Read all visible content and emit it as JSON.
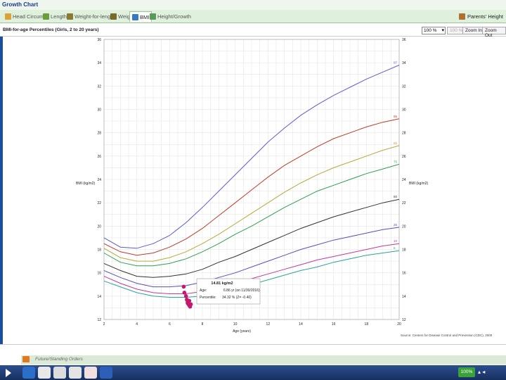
{
  "window": {
    "title": "Growth Chart"
  },
  "tabs": [
    {
      "label": "Head Circum",
      "icon": "head-icon",
      "active": false
    },
    {
      "label": "Length",
      "icon": "length-icon",
      "active": false
    },
    {
      "label": "Weight-for-length",
      "icon": "weight-for-length-icon",
      "active": false
    },
    {
      "label": "Weight",
      "icon": "weight-icon",
      "active": false
    },
    {
      "label": "BMI",
      "icon": "bmi-icon",
      "active": true
    },
    {
      "label": "Height/Growth",
      "icon": "height-icon",
      "active": false
    }
  ],
  "toolbar": {
    "parents_height": "Parents' Height"
  },
  "subbar": {
    "chart_title": "BMI-for-age Percentiles (Girls, 2 to 20 years)",
    "zoom_value": "100 %",
    "zoom_display": "100 %",
    "zoom_in": "Zoom In",
    "zoom_out": "Zoom Out"
  },
  "tooltip": {
    "value": "14.81 kg/m2",
    "age_label": "Age:",
    "age_value": "6.86 yr (on 11/30/2016)",
    "percentile_label": "Percentile:",
    "percentile_value": "34.32 % (Z= -0.40)"
  },
  "source": "Source: Centers for Disease Control and Prevention (CDC), 2000",
  "orders": {
    "label": "Future/Standing Orders"
  },
  "taskbar": {
    "tray_label": "100%"
  },
  "chart_data": {
    "type": "line",
    "xlabel": "Age (years)",
    "ylabel": "BMI (kg/m2)",
    "ylabel_right": "BMI (kg/m2)",
    "xlim": [
      2,
      20
    ],
    "ylim": [
      12,
      36
    ],
    "x_ticks": [
      2,
      4,
      6,
      8,
      10,
      12,
      14,
      16,
      18,
      20
    ],
    "y_ticks": [
      12,
      14,
      16,
      18,
      20,
      22,
      24,
      26,
      28,
      30,
      32,
      34,
      36
    ],
    "x": [
      2,
      3,
      4,
      5,
      6,
      7,
      8,
      9,
      10,
      11,
      12,
      13,
      14,
      15,
      16,
      17,
      18,
      19,
      20
    ],
    "series": [
      {
        "name": "97",
        "color": "#5b5bd6",
        "values": [
          19.0,
          18.2,
          18.1,
          18.5,
          19.2,
          20.3,
          21.6,
          23.0,
          24.4,
          25.8,
          27.2,
          28.4,
          29.5,
          30.4,
          31.2,
          31.9,
          32.6,
          33.2,
          33.8
        ]
      },
      {
        "name": "95",
        "color": "#c0392b",
        "values": [
          18.5,
          17.8,
          17.5,
          17.7,
          18.2,
          18.9,
          19.8,
          20.9,
          22.0,
          23.1,
          24.2,
          25.2,
          26.0,
          26.8,
          27.5,
          28.0,
          28.5,
          28.9,
          29.2
        ]
      },
      {
        "name": "85",
        "color": "#b8a838",
        "values": [
          18.1,
          17.3,
          17.0,
          17.0,
          17.3,
          17.8,
          18.5,
          19.3,
          20.2,
          21.1,
          22.0,
          22.9,
          23.7,
          24.4,
          25.0,
          25.5,
          26.0,
          26.5,
          26.9
        ]
      },
      {
        "name": "75",
        "color": "#2e9e52",
        "values": [
          17.7,
          16.9,
          16.6,
          16.6,
          16.8,
          17.2,
          17.8,
          18.5,
          19.3,
          20.0,
          20.8,
          21.6,
          22.3,
          23.0,
          23.5,
          24.0,
          24.5,
          24.9,
          25.3
        ]
      },
      {
        "name": "50",
        "color": "#333333",
        "values": [
          16.8,
          16.2,
          15.7,
          15.6,
          15.7,
          15.9,
          16.3,
          16.9,
          17.4,
          18.0,
          18.6,
          19.2,
          19.8,
          20.3,
          20.8,
          21.2,
          21.6,
          22.0,
          22.3
        ]
      },
      {
        "name": "25",
        "color": "#5a4fb8",
        "values": [
          16.2,
          15.6,
          15.1,
          14.8,
          14.8,
          14.9,
          15.2,
          15.6,
          16.0,
          16.5,
          17.0,
          17.5,
          18.0,
          18.4,
          18.8,
          19.1,
          19.4,
          19.7,
          19.9
        ]
      },
      {
        "name": "10",
        "color": "#c03a9b",
        "values": [
          15.7,
          15.1,
          14.6,
          14.3,
          14.2,
          14.2,
          14.4,
          14.7,
          15.1,
          15.5,
          15.9,
          16.3,
          16.7,
          17.1,
          17.4,
          17.7,
          18.0,
          18.3,
          18.5
        ]
      },
      {
        "name": "5",
        "color": "#2aa39a",
        "values": [
          15.3,
          14.8,
          14.3,
          14.0,
          13.9,
          13.9,
          14.0,
          14.3,
          14.6,
          15.0,
          15.4,
          15.8,
          16.2,
          16.5,
          16.9,
          17.2,
          17.5,
          17.7,
          17.9
        ]
      }
    ],
    "patient_points": {
      "color": "#c2186e",
      "x": [
        6.86,
        6.9,
        7.0,
        7.05,
        7.1,
        7.15,
        7.2,
        7.25,
        7.3,
        7.2,
        7.1
      ],
      "y": [
        14.81,
        14.3,
        14.0,
        13.7,
        13.5,
        13.3,
        13.2,
        13.1,
        13.3,
        13.6,
        13.4
      ]
    }
  }
}
